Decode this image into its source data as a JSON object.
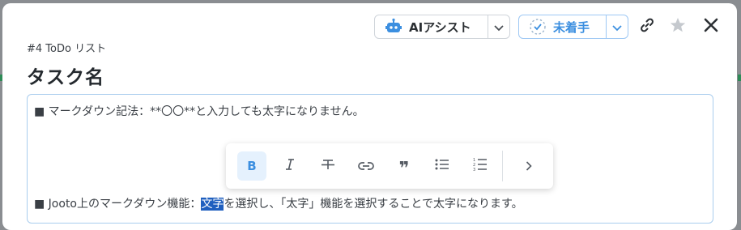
{
  "header": {
    "ai_assist_label": "AIアシスト",
    "status_label": "未着手",
    "icons": [
      "robot-icon",
      "chevron-down-icon",
      "dashed-check-circle-icon",
      "link-icon",
      "star-icon",
      "close-icon"
    ]
  },
  "task": {
    "breadcrumb": "#4 ToDo リスト",
    "title": "タスク名"
  },
  "editor": {
    "line1": "■ マークダウン記法：**〇〇**と入力しても太字になりません。",
    "line2_before": "■ Jooto上のマークダウン機能：",
    "line2_selected": "文字",
    "line2_after": "を選択し、「太字」機能を選択することで太字になります。"
  },
  "format_toolbar": {
    "buttons": [
      "bold",
      "italic",
      "strikethrough",
      "link",
      "quote",
      "bullet-list",
      "numbered-list",
      "more"
    ],
    "bold_label": "B",
    "active": "bold"
  },
  "colors": {
    "accent": "#3c8fe0",
    "selection": "#1f5fbf",
    "overlay": "#8a8d91"
  }
}
